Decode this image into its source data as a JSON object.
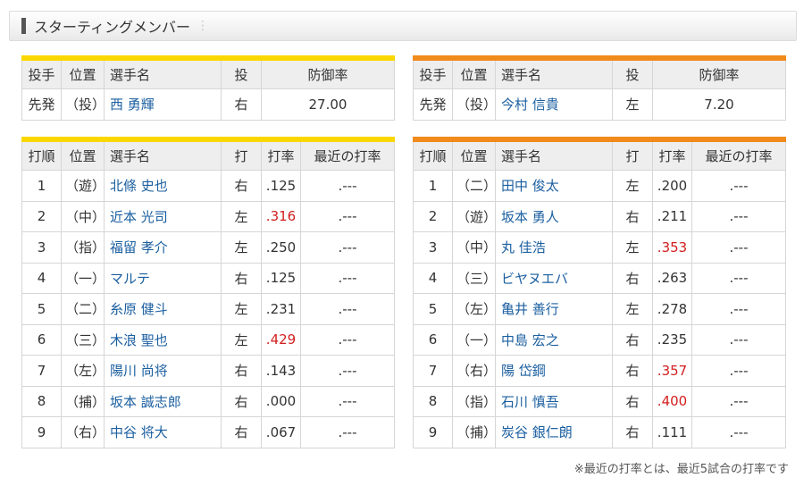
{
  "section_title": "スターティングメンバー",
  "pitcher_headers": [
    "投手",
    "位置",
    "選手名",
    "投",
    "防御率"
  ],
  "batter_headers": [
    "打順",
    "位置",
    "選手名",
    "打",
    "打率",
    "最近の打率"
  ],
  "left": {
    "pitcher": {
      "role": "先発",
      "pos": "（投）",
      "name": "西 勇輝",
      "hand": "右",
      "era": "27.00"
    },
    "batters": [
      {
        "order": "1",
        "pos": "（遊）",
        "name": "北條 史也",
        "hand": "右",
        "avg": ".125",
        "recent": ".---",
        "high": false
      },
      {
        "order": "2",
        "pos": "（中）",
        "name": "近本 光司",
        "hand": "左",
        "avg": ".316",
        "recent": ".---",
        "high": true
      },
      {
        "order": "3",
        "pos": "（指）",
        "name": "福留 孝介",
        "hand": "左",
        "avg": ".250",
        "recent": ".---",
        "high": false
      },
      {
        "order": "4",
        "pos": "（一）",
        "name": "マルテ",
        "hand": "右",
        "avg": ".125",
        "recent": ".---",
        "high": false
      },
      {
        "order": "5",
        "pos": "（二）",
        "name": "糸原 健斗",
        "hand": "左",
        "avg": ".231",
        "recent": ".---",
        "high": false
      },
      {
        "order": "6",
        "pos": "（三）",
        "name": "木浪 聖也",
        "hand": "左",
        "avg": ".429",
        "recent": ".---",
        "high": true
      },
      {
        "order": "7",
        "pos": "（左）",
        "name": "陽川 尚将",
        "hand": "右",
        "avg": ".143",
        "recent": ".---",
        "high": false
      },
      {
        "order": "8",
        "pos": "（捕）",
        "name": "坂本 誠志郎",
        "hand": "右",
        "avg": ".000",
        "recent": ".---",
        "high": false
      },
      {
        "order": "9",
        "pos": "（右）",
        "name": "中谷 将大",
        "hand": "右",
        "avg": ".067",
        "recent": ".---",
        "high": false
      }
    ]
  },
  "right": {
    "pitcher": {
      "role": "先発",
      "pos": "（投）",
      "name": "今村 信貴",
      "hand": "左",
      "era": "7.20"
    },
    "batters": [
      {
        "order": "1",
        "pos": "（二）",
        "name": "田中 俊太",
        "hand": "左",
        "avg": ".200",
        "recent": ".---",
        "high": false
      },
      {
        "order": "2",
        "pos": "（遊）",
        "name": "坂本 勇人",
        "hand": "右",
        "avg": ".211",
        "recent": ".---",
        "high": false
      },
      {
        "order": "3",
        "pos": "（中）",
        "name": "丸 佳浩",
        "hand": "左",
        "avg": ".353",
        "recent": ".---",
        "high": true
      },
      {
        "order": "4",
        "pos": "（三）",
        "name": "ビヤヌエバ",
        "hand": "右",
        "avg": ".263",
        "recent": ".---",
        "high": false
      },
      {
        "order": "5",
        "pos": "（左）",
        "name": "亀井 善行",
        "hand": "左",
        "avg": ".278",
        "recent": ".---",
        "high": false
      },
      {
        "order": "6",
        "pos": "（一）",
        "name": "中島 宏之",
        "hand": "右",
        "avg": ".235",
        "recent": ".---",
        "high": false
      },
      {
        "order": "7",
        "pos": "（右）",
        "name": "陽 岱鋼",
        "hand": "右",
        "avg": ".357",
        "recent": ".---",
        "high": true
      },
      {
        "order": "8",
        "pos": "（指）",
        "name": "石川 慎吾",
        "hand": "右",
        "avg": ".400",
        "recent": ".---",
        "high": true
      },
      {
        "order": "9",
        "pos": "（捕）",
        "name": "炭谷 銀仁朗",
        "hand": "右",
        "avg": ".111",
        "recent": ".---",
        "high": false
      }
    ]
  },
  "colors": {
    "left_team": "#fbd700",
    "right_team": "#f08b1c",
    "name_link": "#1b5fa0",
    "high_avg": "#d21e1e"
  },
  "footnote": "※最近の打率とは、最近5試合の打率です"
}
